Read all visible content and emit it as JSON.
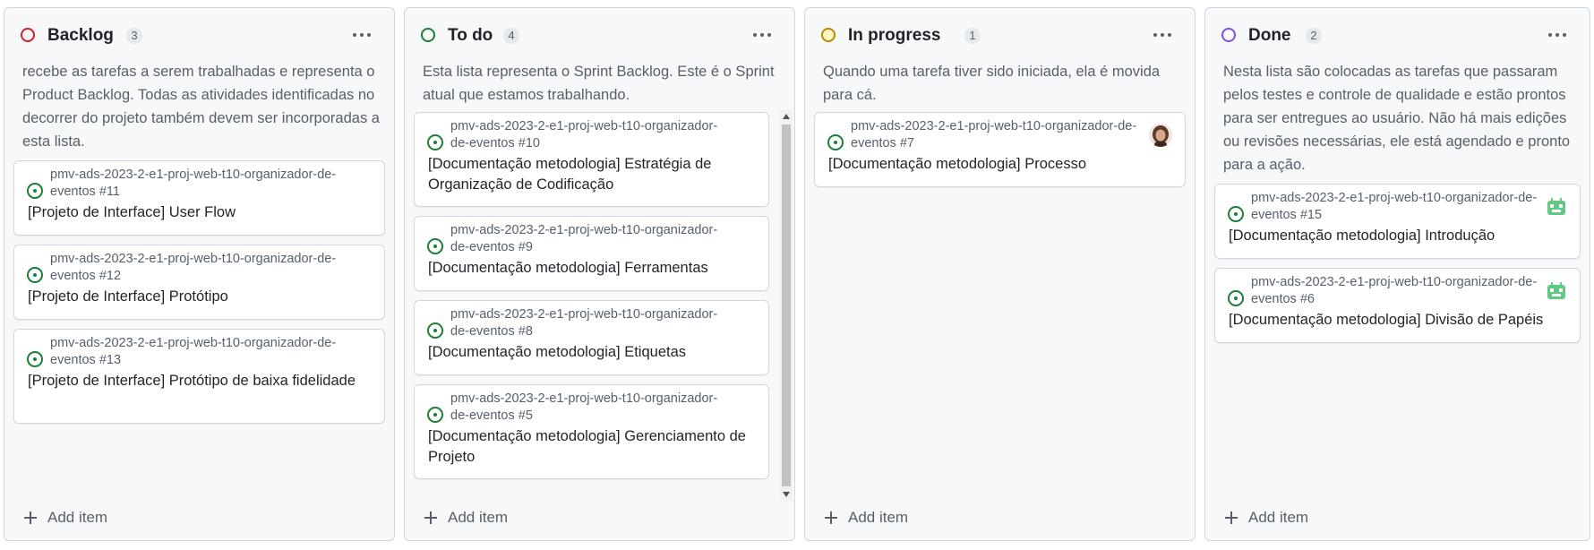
{
  "colors": {
    "backlog": "#cf222e",
    "todo": "#1a7f37",
    "in_progress": "#bf8700",
    "done": "#8250df",
    "issue_open": "#1a7f37"
  },
  "columns": [
    {
      "title": "Backlog",
      "count": "3",
      "description": "recebe as tarefas a serem trabalhadas e representa o Product Backlog. Todas as atividades identificadas no decorrer do projeto também devem ser incorporadas a esta lista.",
      "add_label": "Add item",
      "cards": [
        {
          "repo": "pmv-ads-2023-2-e1-proj-web-t10-organizador-de-eventos #11",
          "title": "[Projeto de Interface] User Flow"
        },
        {
          "repo": "pmv-ads-2023-2-e1-proj-web-t10-organizador-de-eventos #12",
          "title": "[Projeto de Interface] Protótipo"
        },
        {
          "repo": "pmv-ads-2023-2-e1-proj-web-t10-organizador-de-eventos #13",
          "title": "[Projeto de Interface] Protótipo de baixa fidelidade"
        }
      ]
    },
    {
      "title": "To do",
      "count": "4",
      "description": "Esta lista representa o Sprint Backlog. Este é o Sprint atual que estamos trabalhando.",
      "add_label": "Add item",
      "cards": [
        {
          "repo": "pmv-ads-2023-2-e1-proj-web-t10-organizador-de-eventos #10",
          "title": "[Documentação metodologia] Estratégia de Organização de Codificação"
        },
        {
          "repo": "pmv-ads-2023-2-e1-proj-web-t10-organizador-de-eventos #9",
          "title": "[Documentação metodologia] Ferramentas"
        },
        {
          "repo": "pmv-ads-2023-2-e1-proj-web-t10-organizador-de-eventos #8",
          "title": "[Documentação metodologia] Etiquetas"
        },
        {
          "repo": "pmv-ads-2023-2-e1-proj-web-t10-organizador-de-eventos #5",
          "title": "[Documentação metodologia] Gerenciamento de Projeto"
        }
      ]
    },
    {
      "title": "In progress",
      "count": "1",
      "description": "Quando uma tarefa tiver sido iniciada, ela é movida para cá.",
      "add_label": "Add item",
      "cards": [
        {
          "repo": "pmv-ads-2023-2-e1-proj-web-t10-organizador-de-eventos #7",
          "title": "[Documentação metodologia] Processo"
        }
      ]
    },
    {
      "title": "Done",
      "count": "2",
      "description": "Nesta lista são colocadas as tarefas que passaram pelos testes e controle de qualidade e estão prontos para ser entregues ao usuário. Não há mais edições ou revisões necessárias, ele está agendado e pronto para a ação.",
      "add_label": "Add item",
      "cards": [
        {
          "repo": "pmv-ads-2023-2-e1-proj-web-t10-organizador-de-eventos #15",
          "title": "[Documentação metodologia] Introdução"
        },
        {
          "repo": "pmv-ads-2023-2-e1-proj-web-t10-organizador-de-eventos #6",
          "title": "[Documentação metodologia] Divisão de Papéis"
        }
      ]
    }
  ]
}
